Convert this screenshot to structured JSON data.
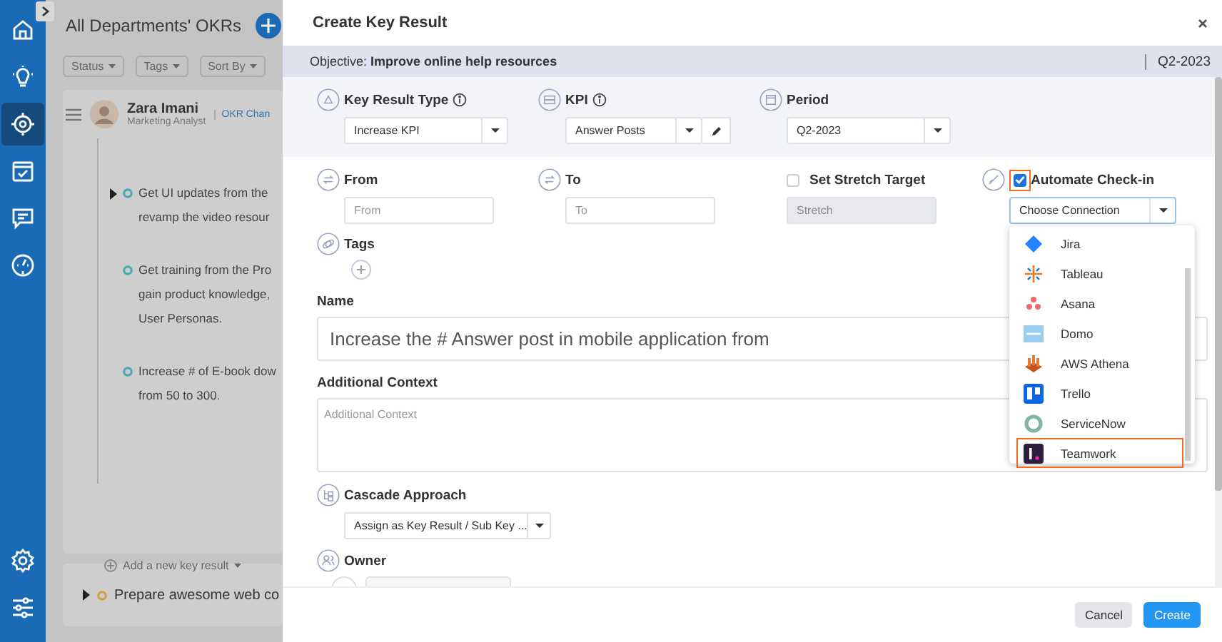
{
  "sidebar": {
    "items": [
      {
        "selected": false
      },
      {
        "selected": false
      },
      {
        "selected": true
      },
      {
        "selected": false
      },
      {
        "selected": false
      },
      {
        "selected": false
      }
    ]
  },
  "page": {
    "title": "All Departments' OKRs",
    "filters": [
      "Status",
      "Tags",
      "Sort By"
    ],
    "user": {
      "name": "Zara Imani",
      "role": "Marketing Analyst"
    },
    "link": "OKR Chan",
    "key_results": [
      {
        "lines": [
          "Get UI updates from the",
          "revamp the video resour"
        ],
        "expandable": true
      },
      {
        "lines": [
          "Get training from the Pro",
          "gain product knowledge,",
          "User Personas."
        ],
        "expandable": false
      },
      {
        "lines": [
          "Increase # of E-book dow",
          "from 50 to 300."
        ],
        "expandable": false
      }
    ],
    "add_key_result": "Add a new key result",
    "objective": {
      "text": "Prepare awesome web co",
      "expandable": true
    }
  },
  "modal": {
    "title": "Create Key Result",
    "objective": "Objective: **Improve online help resources**",
    "period_badge": "Q2-2023",
    "key_result_type": {
      "label": "Key Result Type",
      "value": "Increase KPI"
    },
    "kpi": {
      "label": "KPI",
      "value": "Answer Posts"
    },
    "period": {
      "label": "Period",
      "value": "Q2-2023"
    },
    "from": {
      "label": "From",
      "placeholder": "From"
    },
    "to": {
      "label": "To",
      "placeholder": "To"
    },
    "stretch": {
      "label": "Set Stretch Target",
      "checked": false,
      "placeholder": "Stretch"
    },
    "automate": {
      "label": "Automate Check-in",
      "checked": true,
      "highlighted": true,
      "value": "Choose Connection"
    },
    "connections": [
      {
        "name": "Jira",
        "highlighted": false
      },
      {
        "name": "Tableau",
        "highlighted": false
      },
      {
        "name": "Asana",
        "highlighted": false
      },
      {
        "name": "Domo",
        "highlighted": false
      },
      {
        "name": "AWS Athena",
        "highlighted": false
      },
      {
        "name": "Trello",
        "highlighted": false
      },
      {
        "name": "ServiceNow",
        "highlighted": false
      },
      {
        "name": "Teamwork",
        "highlighted": true
      }
    ],
    "tags": {
      "label": "Tags"
    },
    "name": {
      "label": "Name",
      "value": "Increase the # Answer post in mobile application from"
    },
    "context": {
      "label": "Additional Context",
      "placeholder": "Additional Context"
    },
    "cascade": {
      "label": "Cascade Approach",
      "value": "Assign as Key Result / Sub Key ..."
    },
    "owner": {
      "label": "Owner"
    },
    "buttons": [
      "Cancel",
      "Create"
    ]
  }
}
